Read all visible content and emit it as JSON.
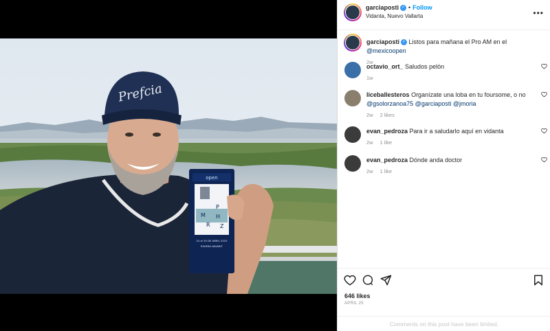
{
  "post": {
    "author": "garciaposti",
    "location": "Vidanta, Nuevo Vallarta",
    "follow_label": "Follow",
    "separator": "•",
    "caption": {
      "username": "garciaposti",
      "text": "Listos para mañana el Pro AM en el",
      "mention": "@mexicoopen",
      "age": "2w"
    },
    "photo": {
      "cap_text": "Prefcia",
      "badge_header": "open",
      "badge_initials": [
        "M",
        "P",
        "H",
        "R",
        "Z"
      ],
      "badge_footer": "24 al 30 DE ABRIL 2023",
      "badge_venue": "RIVIERA NAYARIT"
    }
  },
  "comments": [
    {
      "username": "octavio_ort_",
      "text": "Saludos pelón",
      "age": "1w",
      "likes": ""
    },
    {
      "username": "liceballesteros",
      "text": "Organízate una loba en tu foursome, o no",
      "mentions": "@gsolorzanoa75 @garciaposti @jmoria",
      "age": "2w",
      "likes": "2 likes"
    },
    {
      "username": "evan_pedroza",
      "text": "Para ir a saludarlo aquí en vidanta",
      "age": "2w",
      "likes": "1 like"
    },
    {
      "username": "evan_pedroza",
      "text": "Dónde anda doctor",
      "age": "2w",
      "likes": "1 like"
    }
  ],
  "footer": {
    "likes": "646 likes",
    "date": "APRIL 25",
    "limited": "Comments on this post have been limited."
  },
  "icons": {
    "like": "heart-icon",
    "comment": "comment-icon",
    "share": "share-icon",
    "save": "bookmark-icon",
    "more": "more-options-icon"
  },
  "colors": {
    "follow": "#0095f6",
    "verified": "#3897f0",
    "mention": "#00376b",
    "muted": "#8e8e8e"
  }
}
